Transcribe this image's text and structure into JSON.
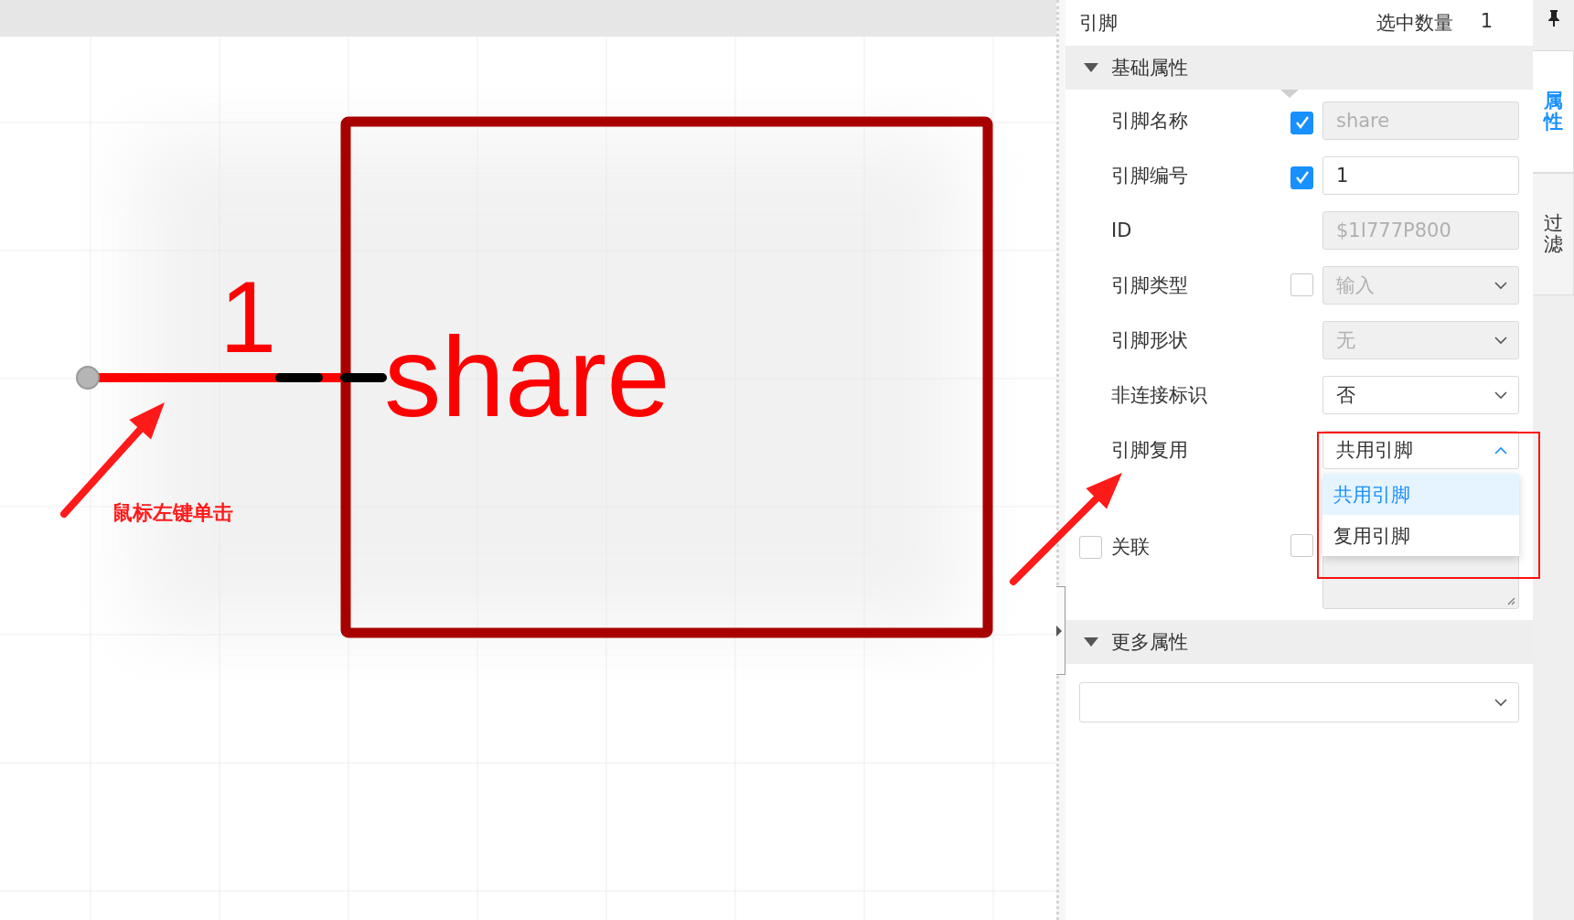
{
  "panel": {
    "title": "引脚",
    "count_label": "选中数量",
    "count": "1"
  },
  "sections": [
    {
      "title": "基础属性",
      "expanded": true,
      "rows": [
        {
          "kind": "input",
          "label": "引脚名称",
          "checkbox": {
            "checked": true
          },
          "value": "share",
          "disabled": true
        },
        {
          "kind": "input",
          "label": "引脚编号",
          "checkbox": {
            "checked": true
          },
          "value": "1",
          "disabled": false
        },
        {
          "kind": "input",
          "label": "ID",
          "value": "$1I777P800",
          "disabled": true
        },
        {
          "kind": "select",
          "label": "引脚类型",
          "checkbox": {
            "checked": false
          },
          "value": "输入",
          "disabled": true
        },
        {
          "kind": "select",
          "label": "引脚形状",
          "value": "无",
          "disabled": true
        },
        {
          "kind": "select",
          "label": "非连接标识",
          "value": "否",
          "disabled": false
        },
        {
          "kind": "select",
          "label": "引脚复用",
          "value": "共用引脚",
          "disabled": false,
          "expanded": true,
          "options": [
            {
              "label": "共用引脚",
              "selected": true
            },
            {
              "label": "复用引脚",
              "selected": false
            }
          ]
        },
        {
          "kind": "textarea",
          "label": "关联",
          "lead_checkbox": {
            "checked": false
          },
          "checkbox": {
            "checked": false
          },
          "disabled": true
        }
      ]
    },
    {
      "title": "更多属性",
      "expanded": true,
      "rows": [
        {
          "kind": "wide_select",
          "disabled": false
        }
      ]
    }
  ],
  "side_tabs": [
    {
      "label": "属性",
      "selected": true
    },
    {
      "label": "过滤",
      "selected": false
    }
  ],
  "canvas": {
    "pin_number": "1",
    "pin_name": "share",
    "annotation": "鼠标左键单击"
  }
}
